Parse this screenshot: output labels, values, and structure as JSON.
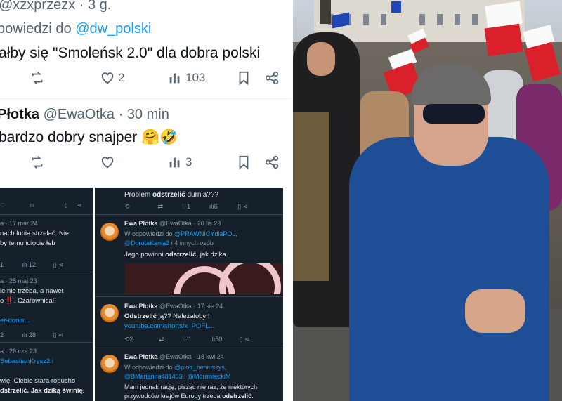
{
  "tweet1": {
    "handle_time": "@xzxprzezx · 3 g.",
    "reply_prefix": "powiedzi do ",
    "reply_target": "@dw_polski",
    "body": "ałby się \"Smoleńsk 2.0\" dla dobra polski",
    "likes": "2",
    "views": "103"
  },
  "tweet2": {
    "name": "Płotka",
    "handle_time": "@EwaOtka · 30 min",
    "body": "bardzo dobry snajper 🤗🤣",
    "views": "3"
  },
  "panel_left": {
    "items": [
      {
        "meta": "a · 17 mar 24",
        "line1": "nach lubią strzelać. Nie",
        "line2": "by temu idiocie łeb",
        "c1": "1",
        "c2": "12"
      },
      {
        "meta": "a · 25 maj 23",
        "line1": "ie nie trzeba, a nawet",
        "line2": "o ‼️. Czarownica!!",
        "link": "er-donis...",
        "c1": "2",
        "c2": "28"
      },
      {
        "meta": "a · 26 cze 23",
        "link": "SebastianKrysz2 i",
        "line1": "wię. Ciebie stara ropucho",
        "line2": "dstrzelić. Jak dziką świnię."
      }
    ]
  },
  "panel_right": {
    "top_text_a": "Problem ",
    "top_text_hl": "odstrzelić",
    "top_text_b": " durnia???",
    "top_counts": {
      "c1": "1",
      "c2": "6"
    },
    "posts": [
      {
        "name": "Ewa Płotka",
        "meta": "@EwaOtka · 20 lis 23",
        "reply_prefix": "W odpowiedzi do ",
        "reply_link1": "@PRAWNICYdlaPOL",
        "reply_link2": "@DorotaKania2",
        "reply_suffix": " i 4 innych osób",
        "body_a": "Jego powinni ",
        "body_hl": "odstrzelić",
        "body_b": ", jak dzika."
      },
      {
        "name": "Ewa Płotka",
        "meta": "@EwaOtka · 17 sie 24",
        "body_hl": "Odstrzelić",
        "body_b": " ją?? Należałoby!!",
        "link": "youtube.com/shorts/x_POFL...",
        "c1": "2",
        "c2": "1",
        "c3": "50"
      },
      {
        "name": "Ewa Płotka",
        "meta": "@EwaOtka · 18 kwi 24",
        "reply_prefix": "W odpowiedzi do ",
        "reply_link1": "@piotr_beniuszys",
        "reply_link2": "@BMarianna481453",
        "reply_mid": " i ",
        "reply_link3": "@MorawieckiM",
        "body_a": "Mam jednak rację, pisząc nie raz, że niektórych",
        "body_c": "przywódców krajów Europy trzeba ",
        "body_hl": "odstrzelić",
        "body_b": "."
      }
    ]
  },
  "colors": {
    "link": "#1d9bf0",
    "dark_panel": "#15202b",
    "flag_red": "#d9202b",
    "eu_blue": "#1f46b4"
  },
  "icons": [
    "retweet-icon",
    "heart-icon",
    "views-icon",
    "bookmark-icon",
    "share-icon"
  ]
}
